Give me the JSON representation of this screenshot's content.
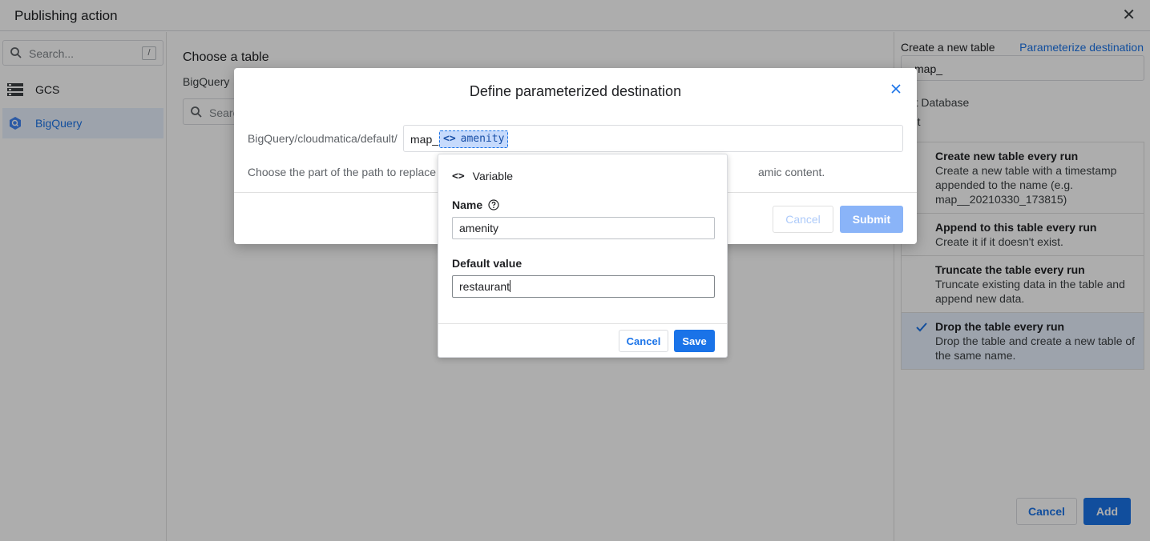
{
  "window": {
    "title": "Publishing action",
    "close_glyph": "✕"
  },
  "sidebar": {
    "search_placeholder": "Search...",
    "search_shortcut": "/",
    "items": [
      {
        "label": "GCS",
        "icon": "storage-icon"
      },
      {
        "label": "BigQuery",
        "icon": "bigquery-icon",
        "selected": true
      }
    ]
  },
  "main": {
    "heading": "Choose a table",
    "breadcrumb": "BigQuery",
    "search_placeholder": "Searc"
  },
  "right_panel": {
    "create_label": "Create a new table",
    "parameterize_link": "Parameterize destination",
    "table_name_value": "map_",
    "database_label": "put Database",
    "database_value": "ault",
    "options": [
      {
        "title": "Create new table every run",
        "desc": "Create a new table with a timestamp appended to the name (e.g. map__20210330_173815)",
        "selected": false
      },
      {
        "title": "Append to this table every run",
        "desc": "Create it if it doesn't exist.",
        "selected": false
      },
      {
        "title": "Truncate the table every run",
        "desc": "Truncate existing data in the table and append new data.",
        "selected": false
      },
      {
        "title": "Drop the table every run",
        "desc": "Drop the table and create a new table of the same name.",
        "selected": true
      }
    ],
    "cancel_label": "Cancel",
    "add_label": "Add"
  },
  "modal": {
    "title": "Define parameterized destination",
    "path_prefix": "BigQuery/cloudmatica/default/",
    "input_prefix": "map_",
    "chip_icon": "<>",
    "chip_label": "amenity",
    "hint_start": "Choose the part of the path to replace",
    "hint_end": "amic content.",
    "cancel_label": "Cancel",
    "submit_label": "Submit"
  },
  "variable_popover": {
    "header_icon": "<>",
    "header_label": "Variable",
    "name_label": "Name",
    "name_value": "amenity",
    "default_label": "Default value",
    "default_value": "restaurant",
    "cancel_label": "Cancel",
    "save_label": "Save"
  },
  "colors": {
    "accent": "#1a73e8",
    "chip_bg": "#c6dafc",
    "overlay": "rgba(0,0,0,0.32)",
    "submit_disabled": "#8ab4f8"
  }
}
